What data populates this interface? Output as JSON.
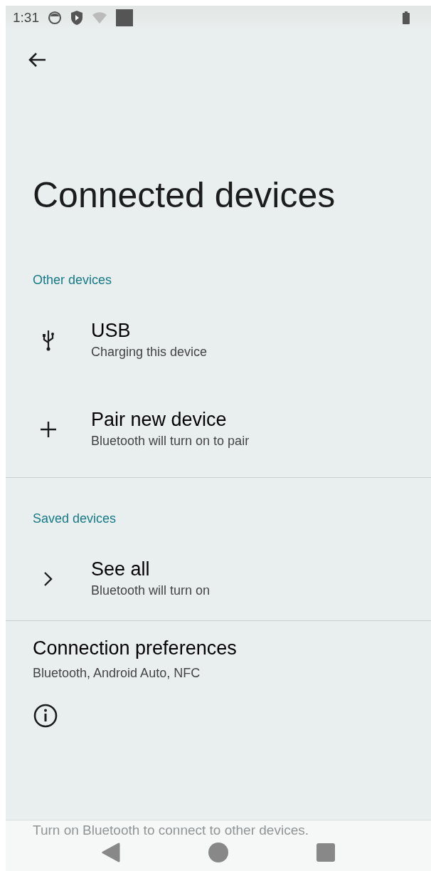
{
  "status_bar": {
    "time": "1:31"
  },
  "title": "Connected devices",
  "sections": [
    {
      "header": "Other devices",
      "items": [
        {
          "kind": "usb",
          "title": "USB",
          "subtitle": "Charging this device"
        },
        {
          "kind": "add",
          "title": "Pair new device",
          "subtitle": "Bluetooth will turn on to pair"
        }
      ]
    },
    {
      "header": "Saved devices",
      "items": [
        {
          "kind": "chevron",
          "title": "See all",
          "subtitle": "Bluetooth will turn on"
        }
      ]
    }
  ],
  "preferences": {
    "title": "Connection preferences",
    "subtitle": "Bluetooth, Android Auto, NFC"
  },
  "footer_text": "Turn on Bluetooth to connect to other devices."
}
